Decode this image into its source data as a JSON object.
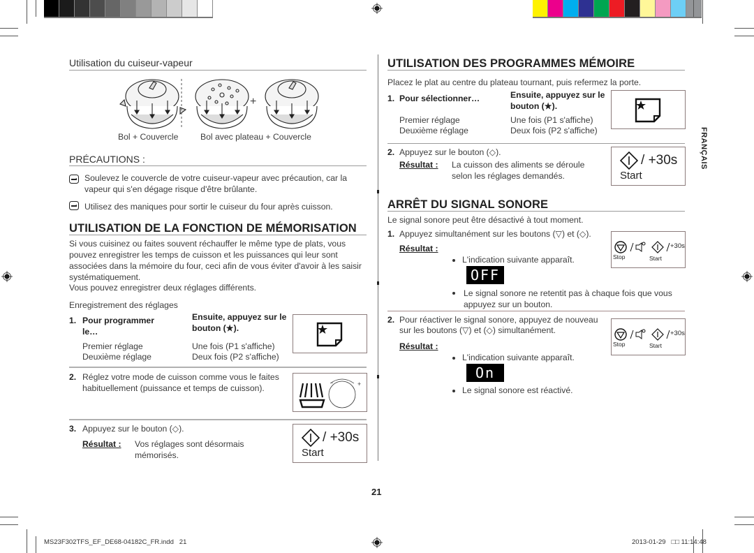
{
  "print_marks": {
    "gray_swatches": [
      "#000000",
      "#1b1b1b",
      "#333333",
      "#4d4d4d",
      "#666666",
      "#808080",
      "#999999",
      "#b3b3b3",
      "#cccccc",
      "#e6e6e6",
      "#ffffff"
    ],
    "color_swatches": [
      "#fff200",
      "#ec008c",
      "#00aeef",
      "#2e3192",
      "#00a651",
      "#ed1c24",
      "#231f20",
      "#fff799",
      "#f49ac1",
      "#6dcff6",
      "#939598"
    ]
  },
  "left": {
    "steamer": {
      "title": "Utilisation du cuiseur-vapeur",
      "caption_1": "Bol + Couvercle",
      "caption_2": "Bol avec plateau + Couvercle",
      "plus": "+"
    },
    "precautions": {
      "title": "PRÉCAUTIONS :",
      "items": [
        "Soulevez le couvercle de votre cuiseur-vapeur avec précaution, car la vapeur qui s'en dégage risque d'être brûlante.",
        "Utilisez des maniques pour sortir le cuiseur du four après cuisson."
      ]
    },
    "memorisation": {
      "title": "UTILISATION DE LA FONCTION DE MÉMORISATION",
      "intro": "Si vous cuisinez ou faites souvent réchauffer le même type de plats, vous pouvez enregistrer les temps de cuisson et les puissances qui leur sont associées dans la mémoire du four, ceci afin de vous éviter d'avoir à les saisir systématiquement.",
      "intro_2": "Vous pouvez enregistrer deux réglages différents.",
      "subtitle": "Enregistrement des réglages",
      "step1": {
        "num": "1.",
        "col1_header": "Pour programmer le…",
        "col2_header": "Ensuite, appuyez sur le bouton (",
        "col2_header_end": ").",
        "rows": [
          {
            "setting": "Premier réglage",
            "action": "Une fois (P1 s'affiche)"
          },
          {
            "setting": "Deuxième réglage",
            "action": "Deux fois (P2 s'affiche)"
          }
        ]
      },
      "step2": {
        "num": "2.",
        "text": "Réglez votre mode de cuisson comme vous le faites habituellement (puissance et temps de cuisson)."
      },
      "step3": {
        "num": "3.",
        "text": "Appuyez sur le bouton (",
        "text_end": ").",
        "result_label": "Résultat :",
        "result_text": "Vos réglages sont désormais mémorisés."
      },
      "dial_minus": "-",
      "dial_plus": "+"
    }
  },
  "right": {
    "programs": {
      "title": "UTILISATION DES PROGRAMMES MÉMOIRE",
      "intro": "Placez le plat au centre du plateau tournant, puis refermez la porte.",
      "step1": {
        "num": "1.",
        "col1_header": "Pour sélectionner…",
        "col2_header": "Ensuite, appuyez sur le bouton (",
        "col2_header_end": ").",
        "rows": [
          {
            "setting": "Premier réglage",
            "action": "Une fois (P1 s'affiche)"
          },
          {
            "setting": "Deuxième réglage",
            "action": "Deux fois (P2 s'affiche)"
          }
        ]
      },
      "step2": {
        "num": "2.",
        "text": "Appuyez sur le bouton (",
        "text_end": ").",
        "result_label": "Résultat :",
        "result_text": "La cuisson des aliments se déroule selon les réglages demandés."
      }
    },
    "beep": {
      "title": "ARRÊT DU SIGNAL SONORE",
      "intro": "Le signal sonore peut être désactivé à tout moment.",
      "step1": {
        "num": "1.",
        "text": "Appuyez simultanément sur les boutons (",
        "text_mid": ") et (",
        "text_end": ").",
        "result_label": "Résultat :",
        "bullet1": "L'indication suivante apparaît.",
        "display": "OFF",
        "bullet2": "Le signal sonore ne retentit pas à chaque fois que vous appuyez sur un bouton."
      },
      "step2": {
        "num": "2.",
        "text_a": "Pour réactiver le signal sonore, appuyez de nouveau",
        "text_b": "sur les boutons (",
        "text_mid": ") et (",
        "text_end": ") simultanément.",
        "result_label": "Résultat :",
        "bullet1": "L'indication suivante apparaît.",
        "display": "On",
        "bullet2": "Le signal sonore est réactivé."
      }
    }
  },
  "buttons": {
    "start_label": "Start",
    "plus30": "+30s",
    "slash": "/",
    "stop_label": "Stop",
    "small_plus30": "+30s"
  },
  "side_tab": "FRANÇAIS",
  "page_number": "21",
  "footer": {
    "file": "MS23F302TFS_EF_DE68-04182C_FR.indd   21",
    "datetime": "2013-01-29   □□ 11:14:48"
  }
}
